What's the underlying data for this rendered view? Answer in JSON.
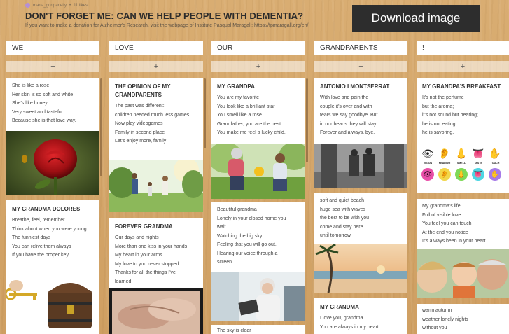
{
  "header": {
    "author": "marta_gorfpanelly",
    "meta_sep": "•",
    "count": "11 likes",
    "title": "DON'T FORGET ME: CAN WE HELP PEOPLE WITH DEMENTIA?",
    "subtitle": "If you want to make a donation for Alzheimer's Research, visit the webpage of Institute Pasqual Maragall: https://fpmaragall.org/en/"
  },
  "download_label": "Download image",
  "add_label": "+",
  "columns": [
    {
      "title": "WE"
    },
    {
      "title": "LOVE"
    },
    {
      "title": "OUR"
    },
    {
      "title": "GRANDPARENTS"
    },
    {
      "title": "!"
    }
  ],
  "cards": {
    "we_rose": {
      "lines": [
        "She is like a rose",
        "Her skin is so soft and white",
        "She's like honey",
        "Very sweet and tasteful",
        "Because she is that love way."
      ]
    },
    "we_dolores": {
      "title": "MY GRANDMA DOLORES",
      "lines": [
        "Breathe, feel, remember...",
        "Think about when you were young",
        "The funniest days",
        "You can relive them always",
        "If you have the proper key"
      ]
    },
    "love_opinion": {
      "title": "THE OPINION OF MY GRANDPARENTS",
      "lines": [
        "The past was different:",
        "children needed much less games.",
        "Now play videogames",
        "Family in second place",
        "Let's enjoy more, family"
      ]
    },
    "love_forever": {
      "title": "FOREVER GRANDMA",
      "lines": [
        "Our days and nights",
        "More than one kiss in your hands",
        "My heart in your arms",
        "My love to you never stopped",
        "Thanks for all the things I've",
        "learned"
      ]
    },
    "our_grandpa": {
      "title": "MY GRANDPA",
      "lines": [
        "You are my favorite",
        "You look like a brilliant star",
        "You smell like a rose",
        "Grandfather, you are the best",
        "You make me feel a lucky child."
      ]
    },
    "our_beautiful": {
      "lines": [
        "Beautiful grandma",
        "Lonely in your closed home you",
        "wait.",
        "Watching the big sky.",
        "Feeling that you will go out.",
        "Hearing our  voice through a",
        "screen."
      ]
    },
    "our_sky": {
      "lines": [
        "The sky is clear"
      ]
    },
    "gp_antonio": {
      "title": "ANTONIO I MONTSERRAT",
      "lines": [
        "With love and pain the",
        "couple it's over and with",
        "tears we say goodbye. But",
        "in our hearts they will stay.",
        "Forever and always, bye."
      ]
    },
    "gp_beach": {
      "lines": [
        "soft and quiet beach",
        "huge sea with waves",
        "the best to be with you",
        "come and stay here",
        "until tomorrow"
      ]
    },
    "gp_mygrandma": {
      "title": "MY GRANDMA",
      "lines": [
        "I love you, grandma",
        "You are always in my heart"
      ]
    },
    "ex_breakfast": {
      "title": "MY GRANDPA'S BREAKFAST",
      "lines": [
        "It's not the perfume",
        "but the aroma;",
        "it's not sound but hearing;",
        "he is not eating,",
        "he is savoring."
      ]
    },
    "ex_life": {
      "lines": [
        "My grandma's life",
        "Full of visible love",
        "You feel you can touch",
        "At the end you notice",
        "It's always been in your heart"
      ]
    },
    "ex_autumn": {
      "lines": [
        "warm autumn",
        "weather lonely nights",
        "without you"
      ]
    }
  },
  "senses": [
    {
      "label": "VISION",
      "icon": "eye-icon",
      "glyph": "👁",
      "color": "#e94fa8"
    },
    {
      "label": "HEARING",
      "icon": "ear-icon",
      "glyph": "👂",
      "color": "#f2d64a"
    },
    {
      "label": "SMELL",
      "icon": "nose-icon",
      "glyph": "👃",
      "color": "#7ed957"
    },
    {
      "label": "TASTE",
      "icon": "tongue-icon",
      "glyph": "👅",
      "color": "#4fd6e3"
    },
    {
      "label": "TOUCH",
      "icon": "hand-icon",
      "glyph": "✋",
      "color": "#a77be8"
    }
  ]
}
